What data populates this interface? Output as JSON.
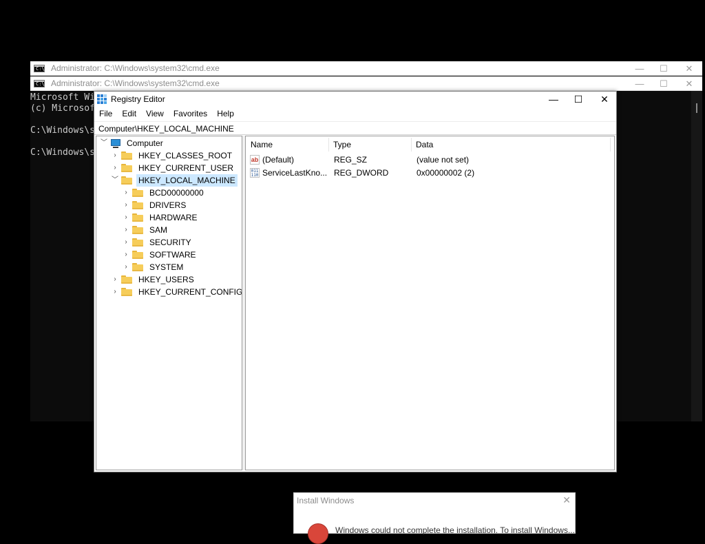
{
  "cmd_windows": [
    {
      "title": "Administrator: C:\\Windows\\system32\\cmd.exe",
      "controls": {
        "minimize": "—",
        "maximize": "☐",
        "close": "✕"
      }
    },
    {
      "title": "Administrator: C:\\Windows\\system32\\cmd.exe",
      "controls": {
        "minimize": "—",
        "maximize": "☐",
        "close": "✕"
      }
    }
  ],
  "cmd_console": {
    "lines": [
      "Microsoft Wi",
      "(c) Microsof",
      "",
      "C:\\Windows\\s",
      "",
      "C:\\Windows\\s"
    ]
  },
  "regedit": {
    "title": "Registry Editor",
    "controls": {
      "minimize": "—",
      "maximize": "☐",
      "close": "✕"
    },
    "menu": [
      "File",
      "Edit",
      "View",
      "Favorites",
      "Help"
    ],
    "address": "Computer\\HKEY_LOCAL_MACHINE",
    "tree": {
      "root": "Computer",
      "hives": [
        {
          "label": "HKEY_CLASSES_ROOT"
        },
        {
          "label": "HKEY_CURRENT_USER"
        },
        {
          "label": "HKEY_LOCAL_MACHINE",
          "selected": true,
          "children": [
            "BCD00000000",
            "DRIVERS",
            "HARDWARE",
            "SAM",
            "SECURITY",
            "SOFTWARE",
            "SYSTEM"
          ]
        },
        {
          "label": "HKEY_USERS"
        },
        {
          "label": "HKEY_CURRENT_CONFIG"
        }
      ]
    },
    "columns": [
      "Name",
      "Type",
      "Data"
    ],
    "values": [
      {
        "icon": "string-value-icon",
        "icon_text": "ab",
        "name": "(Default)",
        "type": "REG_SZ",
        "data": "(value not set)"
      },
      {
        "icon": "binary-value-icon",
        "icon_text": "011 110",
        "name": "ServiceLastKno...",
        "type": "REG_DWORD",
        "data": "0x00000002 (2)"
      }
    ]
  },
  "install_dialog": {
    "title": "Install Windows",
    "close": "✕",
    "message": "Windows could not complete the installation. To install Windows..."
  },
  "colors": {
    "desktop": "#000000",
    "console_bg": "#0c0c0c",
    "selection": "#cce8ff",
    "folder": "#f6cd5a",
    "error": "#d9463a"
  }
}
